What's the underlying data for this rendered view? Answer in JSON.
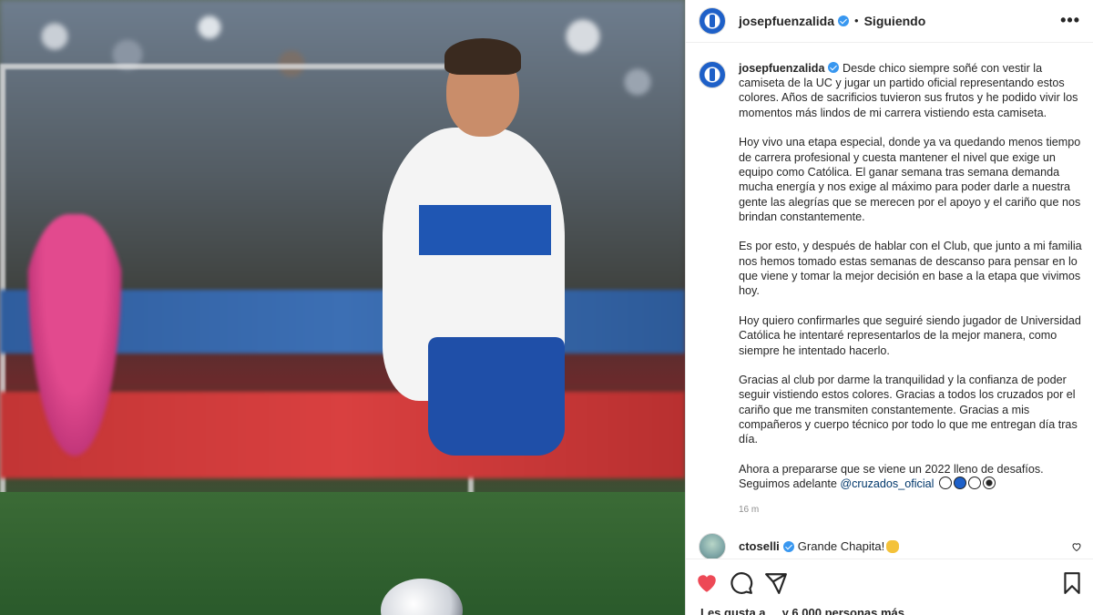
{
  "header": {
    "username": "josepfuenzalida",
    "separator": "•",
    "follow_status": "Siguiendo",
    "more_label": "•••"
  },
  "caption": {
    "username": "josepfuenzalida",
    "paragraphs": [
      "Desde chico siempre soñé con vestir la camiseta de la UC y jugar un partido oficial representando estos colores. Años de sacrificios tuvieron sus frutos y he podido vivir los momentos más lindos de mi carrera vistiendo esta camiseta.",
      "Hoy vivo una etapa especial, donde ya va quedando menos tiempo de carrera profesional y cuesta mantener el nivel que exige un equipo como Católica. El ganar semana tras semana demanda mucha energía y nos exige al máximo para poder darle a nuestra gente las alegrías que se merecen por el apoyo y el cariño que nos brindan constantemente.",
      "Es por esto, y después de hablar con el Club, que junto a mi familia nos hemos tomado estas semanas de descanso para pensar en lo que viene y tomar la mejor decisión en base a la etapa que vivimos hoy.",
      "Hoy quiero confirmarles que seguiré siendo jugador de Universidad Católica he intentaré representarlos de la mejor manera, como siempre he intentado hacerlo.",
      "Gracias al club por darme la tranquilidad y la confianza de poder seguir vistiendo estos colores. Gracias a todos los cruzados por el cariño que me transmiten constantemente. Gracias a mis compañeros y cuerpo técnico por todo lo que me entregan día tras día."
    ],
    "closing_line1": "Ahora a prepararse que se viene un 2022 lleno de desafíos.",
    "closing_line2": "Seguimos adelante",
    "mention": "@cruzados_oficial",
    "timestamp": "16 m"
  },
  "comment": {
    "username": "ctoselli",
    "text": "Grande Chapita!"
  },
  "likes_text": "Les gusta a ... y 6.000 personas más",
  "colors": {
    "verified": "#3897f0",
    "like_red": "#ed4956",
    "mention": "#00376b"
  },
  "icons": [
    "heart-icon",
    "comment-icon",
    "share-icon",
    "bookmark-icon",
    "more-icon",
    "verified-icon"
  ]
}
